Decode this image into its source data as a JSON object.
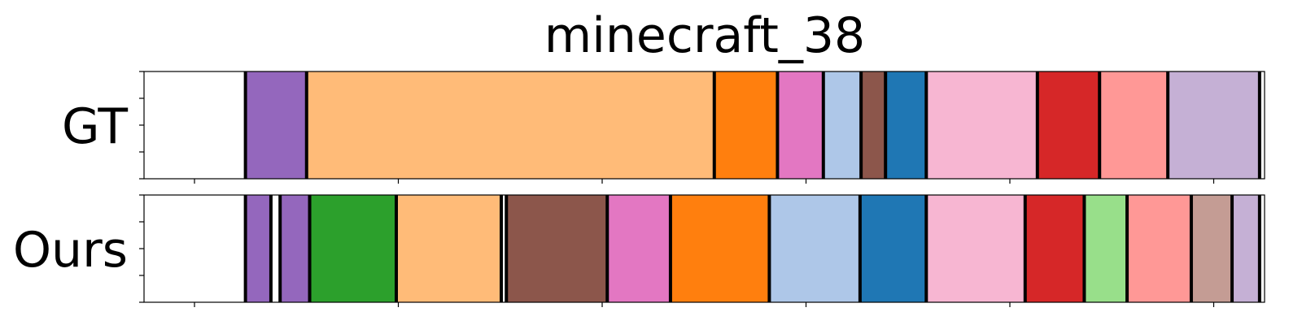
{
  "chart_data": {
    "type": "segment-timeline",
    "title": "minecraft_38",
    "xlim": [
      0,
      100
    ],
    "grid": false,
    "boundary_color": "#000000",
    "rows": [
      {
        "label": "GT",
        "boundaries": [
          5,
          11,
          51,
          57.2,
          61.7,
          65.4,
          67.8,
          71.8,
          82.7,
          88.8,
          95.5,
          104.5
        ],
        "segments": [
          {
            "start": 5,
            "end": 11,
            "color": "#9467bd"
          },
          {
            "start": 11,
            "end": 51,
            "color": "#ffbb78"
          },
          {
            "start": 51,
            "end": 57.2,
            "color": "#ff7f0e"
          },
          {
            "start": 57.2,
            "end": 61.7,
            "color": "#e377c2"
          },
          {
            "start": 61.7,
            "end": 65.4,
            "color": "#aec7e8"
          },
          {
            "start": 65.4,
            "end": 67.8,
            "color": "#8c564b"
          },
          {
            "start": 67.8,
            "end": 71.8,
            "color": "#1f77b4"
          },
          {
            "start": 71.8,
            "end": 82.7,
            "color": "#f7b6d2"
          },
          {
            "start": 82.7,
            "end": 88.8,
            "color": "#d62728"
          },
          {
            "start": 88.8,
            "end": 95.5,
            "color": "#ff9896"
          },
          {
            "start": 95.5,
            "end": 104.5,
            "color": "#c5b0d5"
          }
        ]
      },
      {
        "label": "Ours",
        "boundaries": [
          5,
          7.5,
          8.4,
          11.3,
          19.8,
          30.1,
          30.6,
          40.5,
          46.7,
          56.4,
          65.3,
          71.8,
          81.5,
          87.3,
          91.5,
          97.8,
          101.8,
          104.5
        ],
        "segments": [
          {
            "start": 5,
            "end": 7.5,
            "color": "#9467bd"
          },
          {
            "start": 8.4,
            "end": 11.3,
            "color": "#9467bd"
          },
          {
            "start": 11.3,
            "end": 19.8,
            "color": "#2ca02c"
          },
          {
            "start": 19.8,
            "end": 30.1,
            "color": "#ffbb78"
          },
          {
            "start": 30.6,
            "end": 40.5,
            "color": "#8c564b"
          },
          {
            "start": 40.5,
            "end": 46.7,
            "color": "#e377c2"
          },
          {
            "start": 46.7,
            "end": 56.4,
            "color": "#ff7f0e"
          },
          {
            "start": 56.4,
            "end": 65.3,
            "color": "#aec7e8"
          },
          {
            "start": 65.3,
            "end": 71.8,
            "color": "#1f77b4"
          },
          {
            "start": 71.8,
            "end": 81.5,
            "color": "#f7b6d2"
          },
          {
            "start": 81.5,
            "end": 87.3,
            "color": "#d62728"
          },
          {
            "start": 87.3,
            "end": 91.5,
            "color": "#98df8a"
          },
          {
            "start": 91.5,
            "end": 97.8,
            "color": "#ff9896"
          },
          {
            "start": 97.8,
            "end": 101.8,
            "color": "#c49c94"
          },
          {
            "start": 101.8,
            "end": 104.5,
            "color": "#c5b0d5"
          }
        ]
      }
    ]
  }
}
